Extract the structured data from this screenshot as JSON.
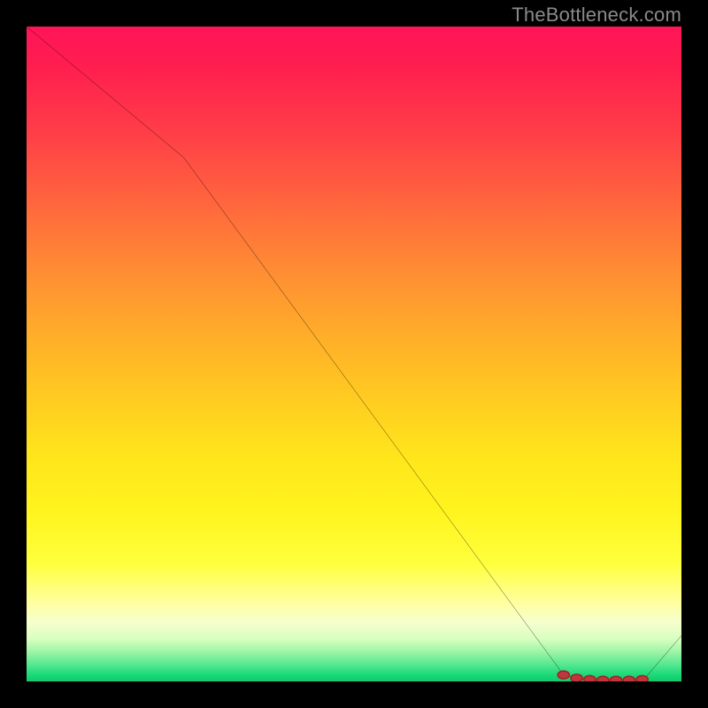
{
  "watermark": {
    "text": "TheBottleneck.com"
  },
  "colors": {
    "bg": "#000000",
    "curve": "#000000",
    "marker_stroke": "#a02028",
    "marker_fill": "#c0363c",
    "gradient_top": "#ff1458",
    "gradient_mid": "#ffe61c",
    "gradient_bottom": "#14c86a"
  },
  "chart_data": {
    "type": "line",
    "title": "",
    "xlabel": "",
    "ylabel": "",
    "xlim": [
      0,
      100
    ],
    "ylim": [
      0,
      100
    ],
    "x": [
      0,
      24,
      82,
      86,
      90,
      94,
      100
    ],
    "values": [
      100,
      80,
      1,
      0,
      0,
      0,
      7
    ],
    "markers": {
      "x": [
        82,
        84,
        86,
        88,
        90,
        92,
        94
      ],
      "y": [
        1,
        0.5,
        0.3,
        0.2,
        0.2,
        0.2,
        0.3
      ]
    }
  }
}
